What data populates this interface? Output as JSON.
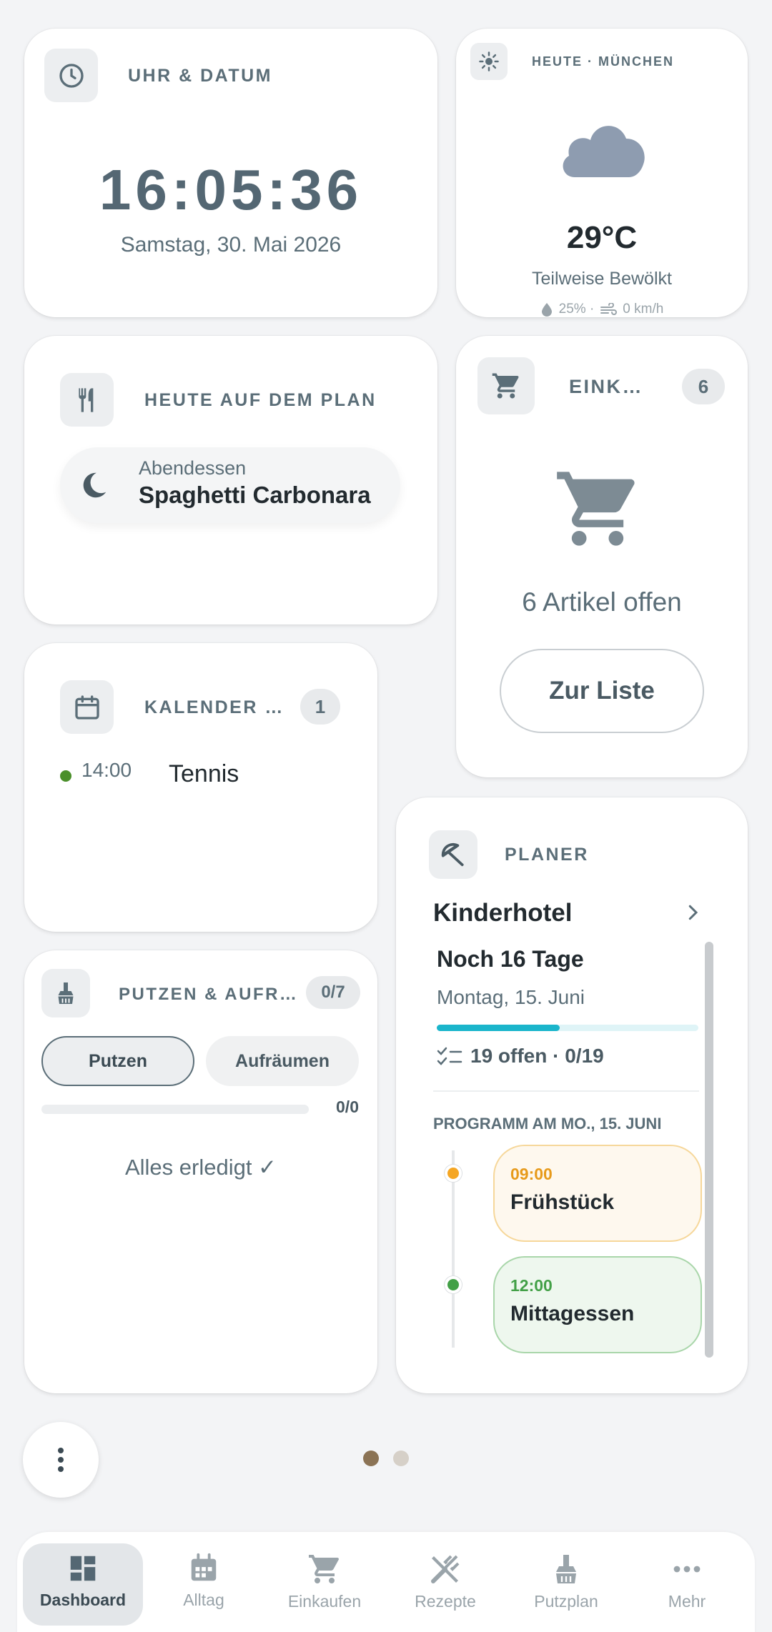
{
  "clock": {
    "title": "UHR & DATUM",
    "time": "16:05:36",
    "date": "Samstag, 30. Mai 2026"
  },
  "weather": {
    "title": "HEUTE · MÜNCHEN",
    "temp": "29°C",
    "condition": "Teilweise Bewölkt",
    "humidity": "25% ·",
    "wind": "0 km/h"
  },
  "plan": {
    "title": "HEUTE AUF DEM PLAN",
    "meal_label": "Abendessen",
    "meal_name": "Spaghetti Carbonara"
  },
  "shopping": {
    "title": "EINK…",
    "count": "6",
    "open_text": "6 Artikel offen",
    "button": "Zur Liste"
  },
  "calendar": {
    "title": "KALENDER …",
    "count": "1",
    "events": [
      {
        "time": "14:00",
        "name": "Tennis"
      }
    ]
  },
  "planner": {
    "title": "PLANER",
    "trip": "Kinderhotel",
    "countdown": "Noch 16 Tage",
    "date": "Montag, 15. Juni",
    "progress": 0.47,
    "open_tasks": "19 offen · 0/19",
    "program_heading": "PROGRAMM AM MO., 15. JUNI",
    "program": [
      {
        "time": "09:00",
        "name": "Frühstück",
        "accent": "#f5a623"
      },
      {
        "time": "12:00",
        "name": "Mittagessen",
        "accent": "#43a047"
      }
    ]
  },
  "cleaning": {
    "title": "PUTZEN & AUFR…",
    "count": "0/7",
    "tab_active": "Putzen",
    "tab_inactive": "Aufräumen",
    "progress_text": "0/0",
    "done_text": "Alles erledigt ✓"
  },
  "pager": {
    "active_color": "#8b7355",
    "inactive_color": "#d6d0c8"
  },
  "nav": [
    {
      "label": "Dashboard",
      "icon": "dashboard-icon",
      "active": true
    },
    {
      "label": "Alltag",
      "icon": "calendar-icon"
    },
    {
      "label": "Einkaufen",
      "icon": "cart-icon"
    },
    {
      "label": "Rezepte",
      "icon": "cutlery-icon"
    },
    {
      "label": "Putzplan",
      "icon": "broom-icon"
    },
    {
      "label": "Mehr",
      "icon": "more-icon"
    }
  ]
}
